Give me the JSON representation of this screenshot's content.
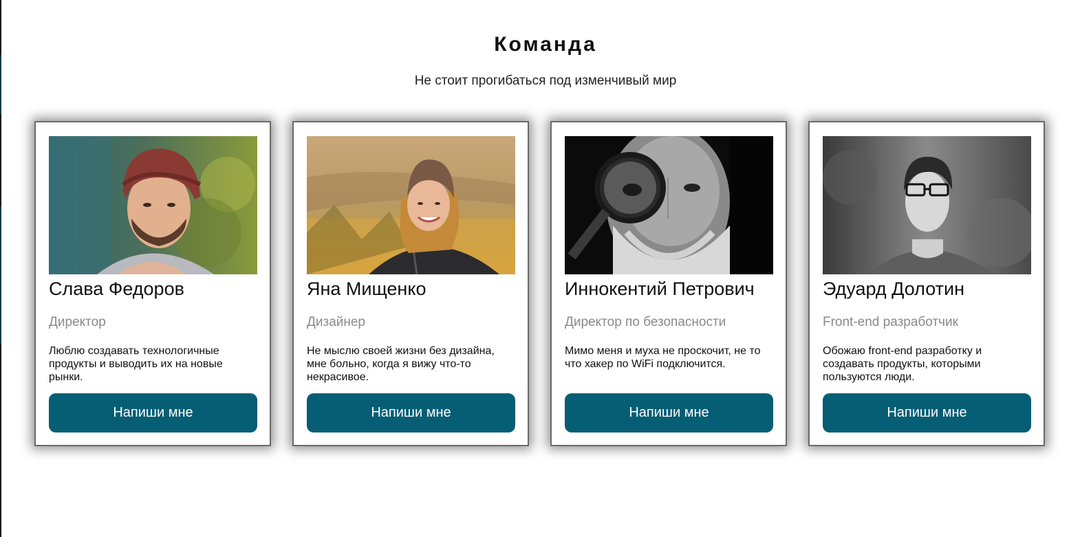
{
  "section": {
    "title": "Команда",
    "subtitle": "Не стоит прогибаться под изменчивый мир"
  },
  "colors": {
    "button_bg": "#065e74",
    "button_text": "#ffffff",
    "role_text": "#8a8a8a",
    "card_border": "#6a6a6a"
  },
  "members": [
    {
      "name": "Слава Федоров",
      "role": "Директор",
      "bio": "Люблю создавать технологичные продукты и выводить их на новые рынки.",
      "button_label": "Напиши мне",
      "photo_subject": "bearded man in red knit beanie"
    },
    {
      "name": "Яна Мищенко",
      "role": "Дизайнер",
      "bio": "Не мыслю своей жизни без дизайна, мне больно, когда я вижу что-то некрасивое.",
      "button_label": "Напиши мне",
      "photo_subject": "smiling woman in knit beanie in a field"
    },
    {
      "name": "Иннокентий Петрович",
      "role": "Директор по безопасности",
      "bio": "Мимо меня и муха не проскочит, не то что хакер по WiFi подключится.",
      "button_label": "Напиши мне",
      "photo_subject": "old man with magnifying glass, black and white"
    },
    {
      "name": "Эдуард Долотин",
      "role": "Front-end разработчик",
      "bio": "Обожаю front-end разработку и создавать продукты, которыми пользуются люди.",
      "button_label": "Напиши мне",
      "photo_subject": "young man with glasses, black and white"
    }
  ]
}
